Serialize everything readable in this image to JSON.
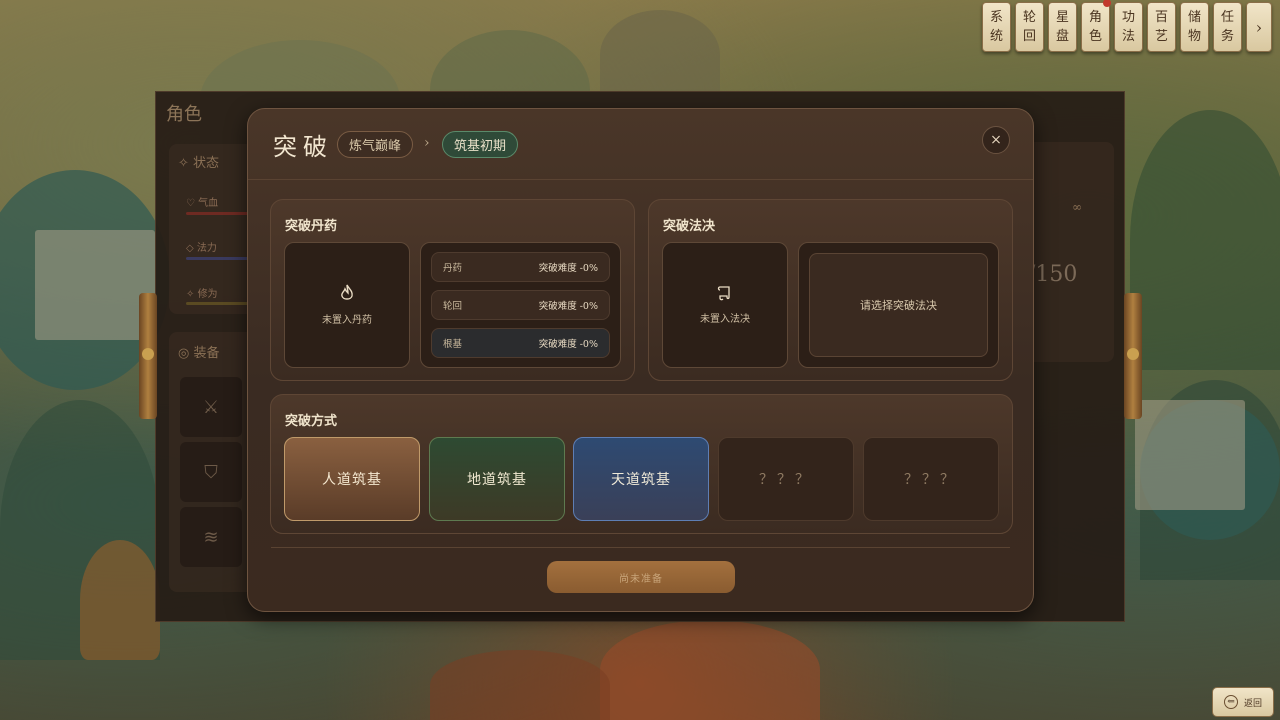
{
  "top_menu": [
    {
      "line1": "系",
      "line2": "统",
      "alert": false
    },
    {
      "line1": "轮",
      "line2": "回",
      "alert": false
    },
    {
      "line1": "星",
      "line2": "盘",
      "alert": false
    },
    {
      "line1": "角",
      "line2": "色",
      "alert": true
    },
    {
      "line1": "功",
      "line2": "法",
      "alert": false
    },
    {
      "line1": "百",
      "line2": "艺",
      "alert": false
    },
    {
      "line1": "储",
      "line2": "物",
      "alert": false
    },
    {
      "line1": "任",
      "line2": "务",
      "alert": false
    }
  ],
  "top_menu_more": "›",
  "character_panel": {
    "title": "角色",
    "status_label": "状态",
    "stats": [
      "气血",
      "法力",
      "修为"
    ],
    "equip_label": "装备",
    "value_partial": "/150",
    "infinity": "∞"
  },
  "breakthrough": {
    "title": "突破",
    "from_realm": "炼气巅峰",
    "arrow": "›",
    "to_realm": "筑基初期",
    "close": "×",
    "pill_section": {
      "title": "突破丹药",
      "slot_icon": "flame-icon",
      "slot_text": "未置入丹药",
      "modifiers": [
        {
          "name": "丹药",
          "value": "突破难度 -0%"
        },
        {
          "name": "轮回",
          "value": "突破难度 -0%"
        },
        {
          "name": "根基",
          "value": "突破难度 -0%"
        }
      ]
    },
    "art_section": {
      "title": "突破法决",
      "slot_icon": "scroll-icon",
      "slot_text": "未置入法决",
      "select_text": "请选择突破法决"
    },
    "method_section": {
      "title": "突破方式",
      "methods": [
        "人道筑基",
        "地道筑基",
        "天道筑基",
        "？？？",
        "？？？"
      ]
    },
    "confirm_label": "尚未准备"
  },
  "back_label": "返回",
  "back_icon": "⇐",
  "colors": {
    "human": "#8a6040",
    "earth": "#2e4a32",
    "heaven": "#2e4a72",
    "to_realm_bg": "#2f4a38",
    "confirm": "#a3703e"
  }
}
